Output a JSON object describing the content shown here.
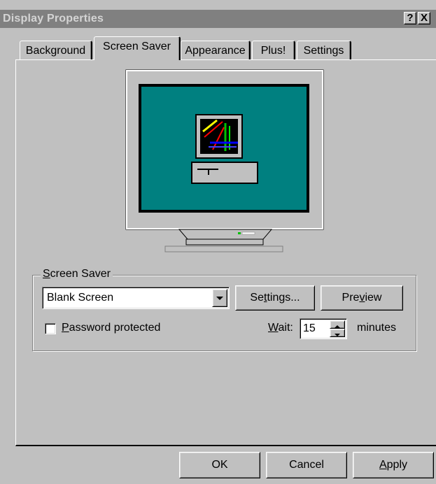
{
  "window": {
    "title": "Display Properties",
    "help_btn": "?",
    "close_btn": "X"
  },
  "tabs": [
    {
      "label": "Background"
    },
    {
      "label": "Screen Saver"
    },
    {
      "label": "Appearance"
    },
    {
      "label": "Plus!"
    },
    {
      "label": "Settings"
    }
  ],
  "screensaver": {
    "group_label_mnemonic": "S",
    "group_label_rest": "creen Saver",
    "selected": "Blank Screen",
    "settings_pre": "Se",
    "settings_mn": "t",
    "settings_post": "tings...",
    "preview_pre": "Pre",
    "preview_mn": "v",
    "preview_post": "iew",
    "password_mn": "P",
    "password_rest": "assword protected",
    "wait_mn": "W",
    "wait_rest": "ait:",
    "wait_value": "15",
    "minutes": "minutes"
  },
  "footer": {
    "ok": "OK",
    "cancel": "Cancel",
    "apply_mn": "A",
    "apply_rest": "pply"
  },
  "colors": {
    "desktop": "#008080",
    "titlebar_inactive": "#808080",
    "face": "#c0c0c0"
  }
}
